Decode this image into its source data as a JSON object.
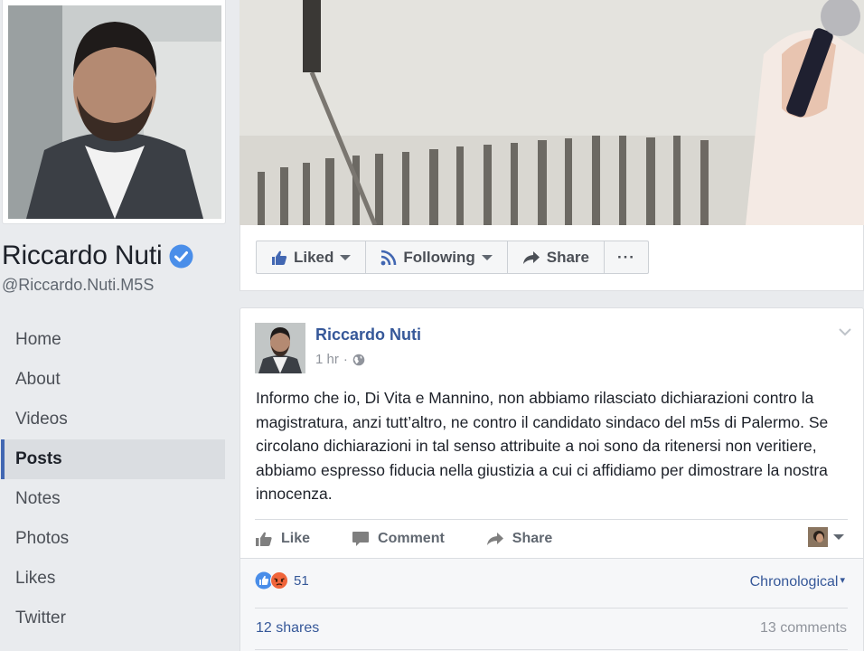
{
  "profile": {
    "name": "Riccardo Nuti",
    "handle": "@Riccardo.Nuti.M5S"
  },
  "nav": {
    "items": [
      {
        "label": "Home",
        "active": false
      },
      {
        "label": "About",
        "active": false
      },
      {
        "label": "Videos",
        "active": false
      },
      {
        "label": "Posts",
        "active": true
      },
      {
        "label": "Notes",
        "active": false
      },
      {
        "label": "Photos",
        "active": false
      },
      {
        "label": "Likes",
        "active": false
      },
      {
        "label": "Twitter",
        "active": false
      }
    ]
  },
  "actionbar": {
    "liked_label": "Liked",
    "following_label": "Following",
    "share_label": "Share",
    "more_label": "···"
  },
  "post": {
    "author": "Riccardo Nuti",
    "time": "1 hr",
    "separator": "·",
    "text": "Informo che io, Di Vita e Mannino, non abbiamo rilasciato dichiarazioni contro la magistratura, anzi tutt’altro, ne contro il candidato sindaco del m5s di Palermo. Se circolano dichiarazioni in tal senso attribuite a noi sono da ritenersi non veritiere, abbiamo espresso fiducia nella giustizia a cui ci affidiamo per dimostrare la nostra innocenza.",
    "actions": {
      "like": "Like",
      "comment": "Comment",
      "share": "Share"
    },
    "reaction_count": "51",
    "sort_label": "Chronological",
    "shares": "12 shares",
    "comments": "13 comments"
  },
  "colors": {
    "link_blue": "#365899",
    "facebook_blue": "#4267b2",
    "verified_blue": "#4a8ee9",
    "angry_orange": "#f0653b"
  },
  "icons": [
    "verified-badge-icon",
    "thumbs-up-icon",
    "rss-icon",
    "share-arrow-icon",
    "globe-icon",
    "chevron-down-icon",
    "comment-icon",
    "like-reaction-icon",
    "angry-reaction-icon"
  ]
}
